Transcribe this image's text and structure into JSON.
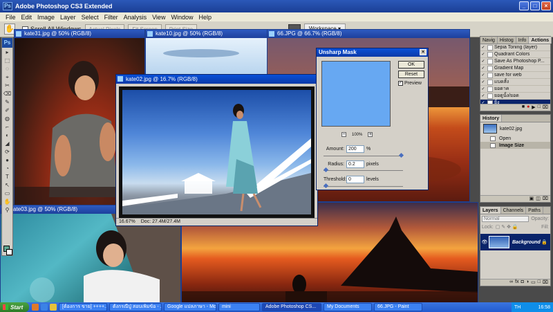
{
  "app": {
    "title": "Adobe Photoshop CS3 Extended",
    "logo": "Ps",
    "window_controls": [
      "_",
      "□",
      "×"
    ]
  },
  "menu": [
    "File",
    "Edit",
    "Image",
    "Layer",
    "Select",
    "Filter",
    "Analysis",
    "View",
    "Window",
    "Help"
  ],
  "options_bar": {
    "tool_icon": "hand-icon",
    "scroll_all": "Scroll All Windows",
    "buttons": [
      "Actual Pixels",
      "Fit Screen",
      "Print Size"
    ],
    "workspace": "Workspace ▾"
  },
  "tools": [
    "▸",
    "⬚",
    "◌",
    "⌖",
    "✂",
    "⌫",
    "✎",
    "✐",
    "◍",
    "⌐",
    "◐",
    "◢",
    "⟳",
    "●",
    "◔",
    "T",
    "↖",
    "▭",
    "✋",
    "⚲"
  ],
  "documents": {
    "kate31": "kate31.jpg @ 50% (RGB/8)",
    "kate10": "kate10.jpg @ 50% (RGB/8)",
    "img66": "66.JPG @ 66.7% (RGB/8)",
    "kate03": "kate03.jpg @ 50% (RGB/8)",
    "kate02": "kate02.jpg @ 16.7% (RGB/8)"
  },
  "active_doc_status": {
    "zoom": "16.67%",
    "doc": "Doc: 27.4M/27.4M"
  },
  "dialog": {
    "title": "Unsharp Mask",
    "ok": "OK",
    "reset": "Reset",
    "preview": "Preview",
    "preview_checked": "✓",
    "zoom": "100%",
    "zoom_minus": "−",
    "zoom_plus": "+",
    "amount_label": "Amount:",
    "amount_value": "200",
    "amount_unit": "%",
    "radius_label": "Radius:",
    "radius_value": "0.2",
    "radius_unit": "pixels",
    "threshold_label": "Threshold:",
    "threshold_value": "0",
    "threshold_unit": "levels"
  },
  "actions_panel": {
    "tabs": [
      "Navig",
      "Histog",
      "Info",
      "Actions"
    ],
    "items": [
      "Sepia Toning (layer)",
      "Quadrant Colors",
      "Save As Photoshop P...",
      "Gradient Map",
      "save for web",
      "แบดสั้ง",
      "ยอดาค",
      "ยอดูนั้ง/ยอด",
      "ยิ้ง"
    ]
  },
  "history_panel": {
    "tab": "History",
    "snapshot": "kate02.jpg",
    "items": [
      "Open",
      "Image Size"
    ]
  },
  "layers_panel": {
    "tabs": [
      "Layers",
      "Channels",
      "Paths"
    ],
    "blend": "Normal",
    "opacity_label": "Opacity:",
    "lock_label": "Lock:",
    "fill_label": "Fill:",
    "layer_name": "Background"
  },
  "taskbar": {
    "start": "Start",
    "items": [
      "[ต้องการ ขาย] ++++...",
      "ตั้งกรณีปู่ สอบเพิ่มข้อ - ...",
      "Google แปลภาษา - Mo...",
      "mini",
      "Adobe Photoshop CS...",
      "My Documents",
      "66.JPG - Paint"
    ],
    "lang": "TH",
    "time": "16:58"
  }
}
